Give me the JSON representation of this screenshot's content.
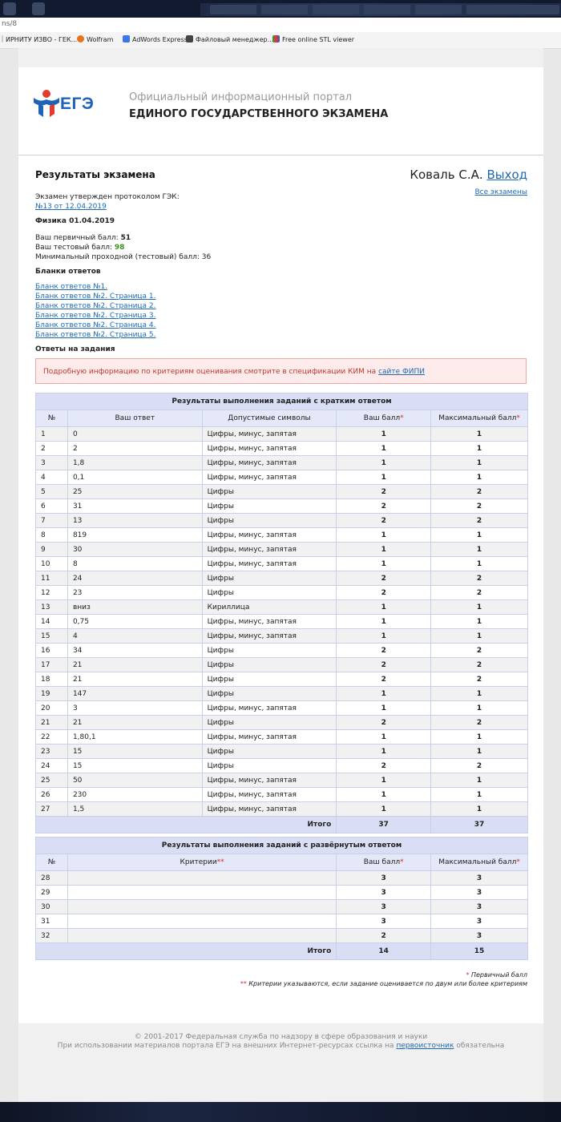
{
  "browser": {
    "url_fragment": "ns/8",
    "bookmarks": [
      {
        "label": "ИРНИТУ ИЗВО - ГЕК...",
        "icon": "page-icon"
      },
      {
        "label": "Wolfram",
        "icon": "wolfram-icon"
      },
      {
        "label": "AdWords Express",
        "icon": "adwords-icon"
      },
      {
        "label": "Файловый менеджер...",
        "icon": "file-manager-icon"
      },
      {
        "label": "Free online STL viewer",
        "icon": "stl-icon"
      }
    ]
  },
  "header": {
    "logo_text": "ЕГЭ",
    "portal_line1": "Официальный информационный портал",
    "portal_line2": "ЕДИНОГО ГОСУДАРСТВЕННОГО ЭКЗАМЕНА"
  },
  "main": {
    "title": "Результаты экзамена",
    "user_name": "Коваль С.А.",
    "logout": "Выход",
    "all_exams": "Все экзамены",
    "protocol_label": "Экзамен утвержден протоколом ГЭК:",
    "protocol_link": "№13 от 12.04.2019",
    "subject": "Физика 01.04.2019",
    "primary_label": "Ваш первичный балл:",
    "primary_value": "51",
    "test_label": "Ваш тестовый балл:",
    "test_value": "98",
    "min_label": "Минимальный проходной (тестовый) балл:",
    "min_value": "36",
    "forms_title": "Бланки ответов",
    "forms": [
      "Бланк ответов №1.",
      "Бланк ответов №2. Страница 1.",
      "Бланк ответов №2. Страница 2.",
      "Бланк ответов №2. Страница 3.",
      "Бланк ответов №2. Страница 4.",
      "Бланк ответов №2. Страница 5."
    ],
    "answers_title": "Ответы на задания",
    "alert_text": "Подробную информацию по критериям оценивания смотрите в спецификации КИМ на",
    "alert_link": "сайте ФИПИ"
  },
  "short_table": {
    "caption": "Результаты выполнения заданий с кратким ответом",
    "columns": [
      "№",
      "Ваш ответ",
      "Допустимые символы",
      "Ваш балл",
      "Максимальный балл"
    ],
    "star": "*",
    "rows": [
      [
        "1",
        "0",
        "Цифры, минус, запятая",
        "1",
        "1"
      ],
      [
        "2",
        "2",
        "Цифры, минус, запятая",
        "1",
        "1"
      ],
      [
        "3",
        "1,8",
        "Цифры, минус, запятая",
        "1",
        "1"
      ],
      [
        "4",
        "0,1",
        "Цифры, минус, запятая",
        "1",
        "1"
      ],
      [
        "5",
        "25",
        "Цифры",
        "2",
        "2"
      ],
      [
        "6",
        "31",
        "Цифры",
        "2",
        "2"
      ],
      [
        "7",
        "13",
        "Цифры",
        "2",
        "2"
      ],
      [
        "8",
        "819",
        "Цифры, минус, запятая",
        "1",
        "1"
      ],
      [
        "9",
        "30",
        "Цифры, минус, запятая",
        "1",
        "1"
      ],
      [
        "10",
        "8",
        "Цифры, минус, запятая",
        "1",
        "1"
      ],
      [
        "11",
        "24",
        "Цифры",
        "2",
        "2"
      ],
      [
        "12",
        "23",
        "Цифры",
        "2",
        "2"
      ],
      [
        "13",
        "вниз",
        "Кириллица",
        "1",
        "1"
      ],
      [
        "14",
        "0,75",
        "Цифры, минус, запятая",
        "1",
        "1"
      ],
      [
        "15",
        "4",
        "Цифры, минус, запятая",
        "1",
        "1"
      ],
      [
        "16",
        "34",
        "Цифры",
        "2",
        "2"
      ],
      [
        "17",
        "21",
        "Цифры",
        "2",
        "2"
      ],
      [
        "18",
        "21",
        "Цифры",
        "2",
        "2"
      ],
      [
        "19",
        "147",
        "Цифры",
        "1",
        "1"
      ],
      [
        "20",
        "3",
        "Цифры, минус, запятая",
        "1",
        "1"
      ],
      [
        "21",
        "21",
        "Цифры",
        "2",
        "2"
      ],
      [
        "22",
        "1,80,1",
        "Цифры, минус, запятая",
        "1",
        "1"
      ],
      [
        "23",
        "15",
        "Цифры",
        "1",
        "1"
      ],
      [
        "24",
        "15",
        "Цифры",
        "2",
        "2"
      ],
      [
        "25",
        "50",
        "Цифры, минус, запятая",
        "1",
        "1"
      ],
      [
        "26",
        "230",
        "Цифры, минус, запятая",
        "1",
        "1"
      ],
      [
        "27",
        "1,5",
        "Цифры, минус, запятая",
        "1",
        "1"
      ]
    ],
    "total_label": "Итого",
    "total_score": "37",
    "total_max": "37"
  },
  "long_table": {
    "caption": "Результаты выполнения заданий с развёрнутым ответом",
    "columns": [
      "№",
      "Критерии",
      "Ваш балл",
      "Максимальный балл"
    ],
    "criteria_star": "**",
    "star": "*",
    "rows": [
      [
        "28",
        "",
        "3",
        "3"
      ],
      [
        "29",
        "",
        "3",
        "3"
      ],
      [
        "30",
        "",
        "3",
        "3"
      ],
      [
        "31",
        "",
        "3",
        "3"
      ],
      [
        "32",
        "",
        "2",
        "3"
      ]
    ],
    "total_label": "Итого",
    "total_score": "14",
    "total_max": "15"
  },
  "notes": {
    "star1": "*",
    "note1": "Первичный балл",
    "star2": "**",
    "note2": "Критерии указываются, если задание оценивается по двум или более критериям"
  },
  "footer": {
    "line1": "© 2001-2017 Федеральная служба по надзору в сфере образования и науки",
    "line2_before": "При использовании материалов портала ЕГЭ на внешних Интернет-ресурсах ссылка на",
    "line2_link": "первоисточник",
    "line2_after": "обязательна"
  },
  "colors": {
    "link": "#1d6ab3",
    "table_header": "#d9def5",
    "alert_bg": "#fdeaea",
    "alert_text": "#c0392b",
    "test_score": "#3b8f1b"
  }
}
